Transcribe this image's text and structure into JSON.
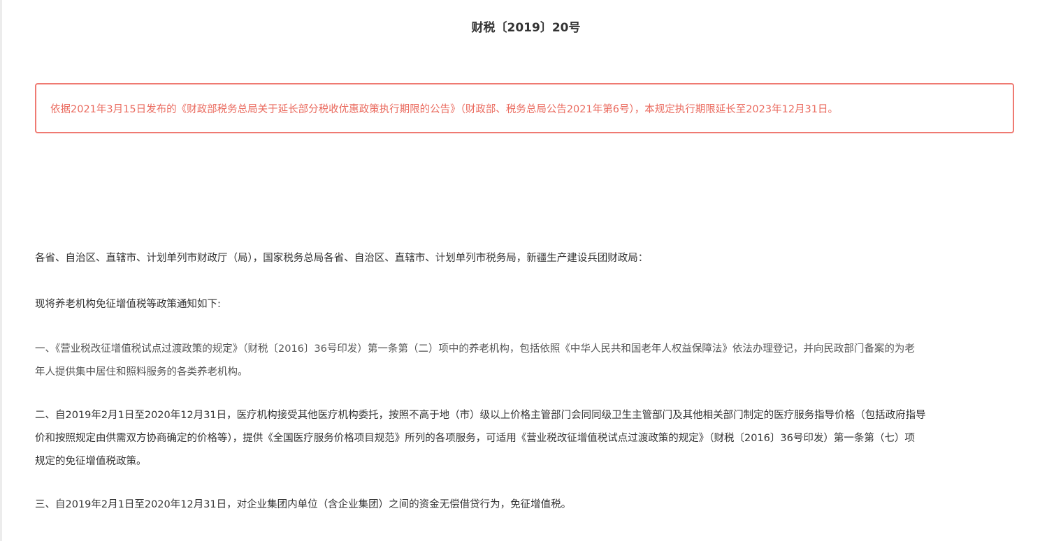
{
  "document": {
    "number": "财税〔2019〕20号",
    "notice": "依据2021年3月15日发布的《财政部税务总局关于延长部分税收优惠政策执行期限的公告》（财政部、税务总局公告2021年第6号），本规定执行期限延长至2023年12月31日。",
    "paragraphs": {
      "address": "各省、自治区、直辖市、计划单列市财政厅（局），国家税务总局各省、自治区、直辖市、计划单列市税务局，新疆生产建设兵团财政局：",
      "intro": "现将养老机构免征增值税等政策通知如下:",
      "item1_line1": "一、《营业税改征增值税试点过渡政策的规定》（财税〔2016〕36号印发）第一条第（二）项中的养老机构，包括依照《中华人民共和国老年人权益保障法》依法办理登记，并向民政部门备案的为老",
      "item1_line2": "年人提供集中居住和照料服务的各类养老机构。",
      "item2_line1": "二、自2019年2月1日至2020年12月31日，医疗机构接受其他医疗机构委托，按照不高于地（市）级以上价格主管部门会同同级卫生主管部门及其他相关部门制定的医疗服务指导价格（包括政府指导",
      "item2_line2": "价和按照规定由供需双方协商确定的价格等），提供《全国医疗服务价格项目规范》所列的各项服务，可适用《营业税改征增值税试点过渡政策的规定》（财税〔2016〕36号印发）第一条第（七）项",
      "item2_line3": "规定的免征增值税政策。",
      "item3": "三、自2019年2月1日至2020年12月31日，对企业集团内单位（含企业集团）之间的资金无偿借贷行为，免征增值税。"
    }
  },
  "colors": {
    "notice_border": "#ef7a72",
    "notice_text": "#ea6a5e",
    "body_text": "#333333"
  }
}
